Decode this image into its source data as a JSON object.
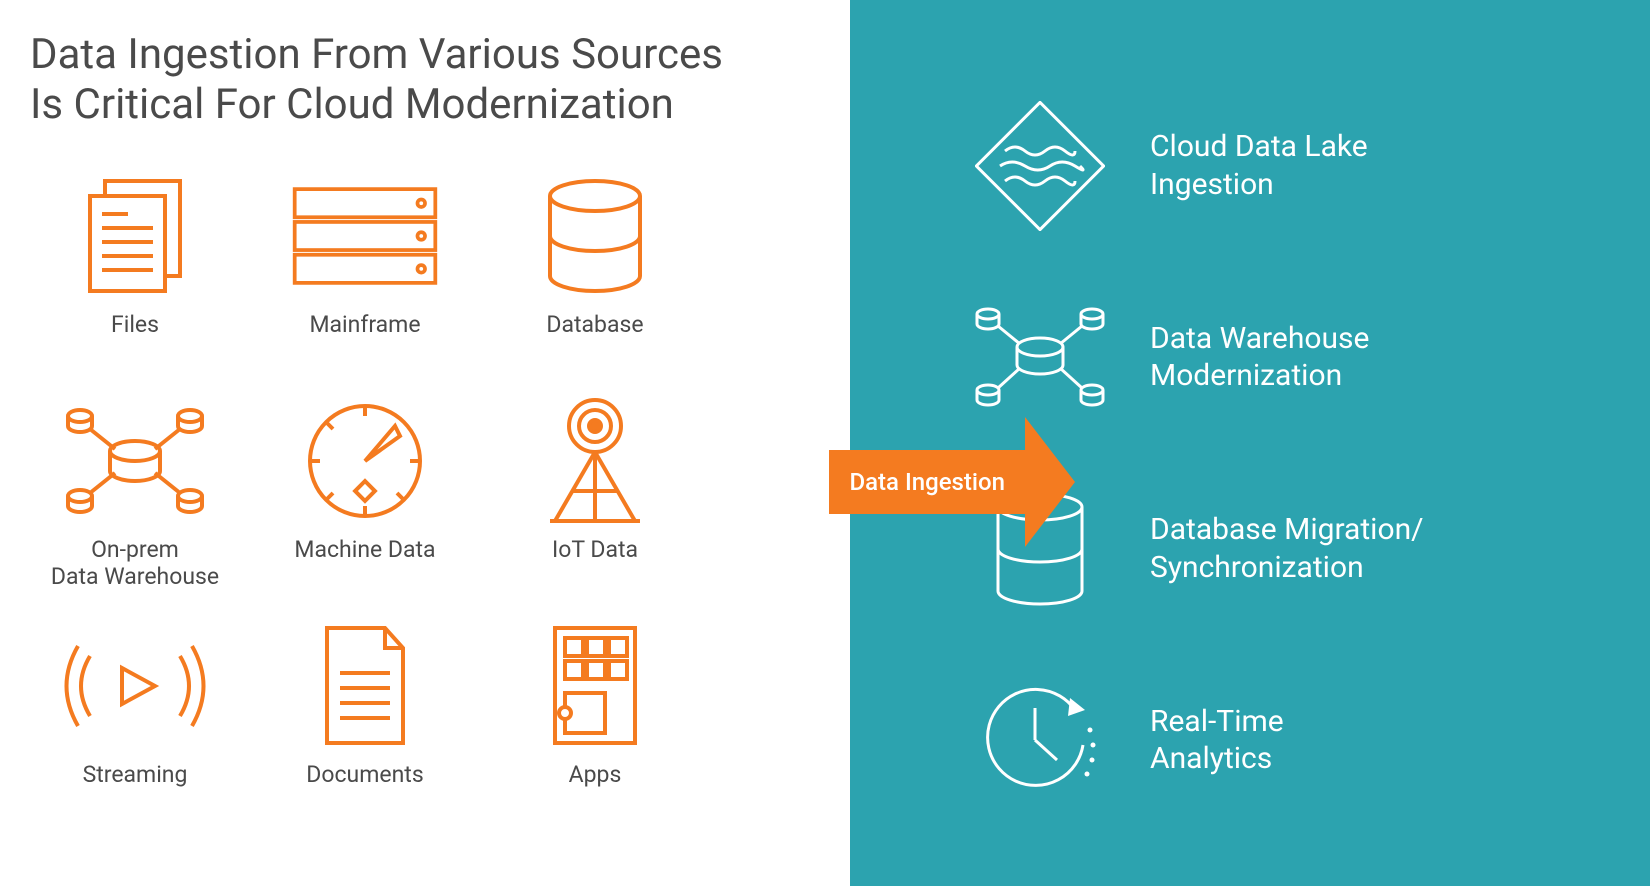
{
  "title": "Data Ingestion From Various Sources\nIs Critical For Cloud Modernization",
  "arrow_label": "Data Ingestion",
  "sources": [
    {
      "label": "Files",
      "icon": "files-icon"
    },
    {
      "label": "Mainframe",
      "icon": "mainframe-icon"
    },
    {
      "label": "Database",
      "icon": "database-icon"
    },
    {
      "label": "On-prem\nData Warehouse",
      "icon": "datawarehouse-icon"
    },
    {
      "label": "Machine Data",
      "icon": "machinedata-icon"
    },
    {
      "label": "IoT Data",
      "icon": "iot-icon"
    },
    {
      "label": "Streaming",
      "icon": "streaming-icon"
    },
    {
      "label": "Documents",
      "icon": "documents-icon"
    },
    {
      "label": "Apps",
      "icon": "apps-icon"
    }
  ],
  "targets": [
    {
      "label": "Cloud Data Lake\nIngestion",
      "icon": "datalake-icon"
    },
    {
      "label": "Data Warehouse\nModernization",
      "icon": "dwh-modern-icon"
    },
    {
      "label": "Database Migration/\nSynchronization",
      "icon": "dbmigration-icon"
    },
    {
      "label": "Real-Time\nAnalytics",
      "icon": "realtime-icon"
    }
  ],
  "colors": {
    "accent": "#f47b20",
    "teal": "#2ca3af",
    "text": "#4a4a4a",
    "white": "#ffffff"
  }
}
